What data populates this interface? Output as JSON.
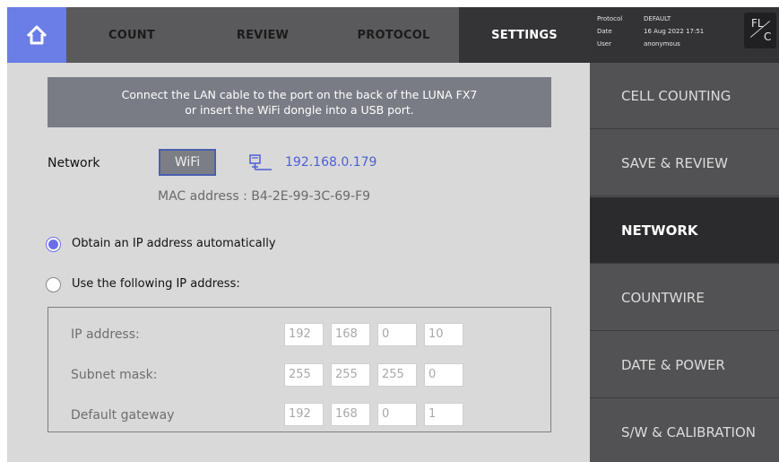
{
  "nav": {
    "home_icon": "home-icon",
    "tabs": [
      "COUNT",
      "REVIEW",
      "PROTOCOL",
      "SETTINGS"
    ],
    "active_tab": "SETTINGS"
  },
  "info": {
    "protocol_label": "Protocol",
    "protocol_value": "DEFAULT",
    "date_label": "Date",
    "date_value": "16 Aug 2022 17:51",
    "user_label": "User",
    "user_value": "anonymous",
    "mode_top": "FL",
    "mode_bottom": "C"
  },
  "menu": {
    "items": [
      "CELL COUNTING",
      "SAVE & REVIEW",
      "NETWORK",
      "COUNTWIRE",
      "DATE & POWER",
      "S/W & CALIBRATION"
    ],
    "active": "NETWORK"
  },
  "banner": {
    "line1": "Connect the LAN cable to the port on the back of the LUNA FX7",
    "line2": "or insert the WiFi dongle into a USB port."
  },
  "network": {
    "label": "Network",
    "wifi_button": "WiFi",
    "ip_icon": "network-icon",
    "ip": "192.168.0.179",
    "mac": "MAC address : B4-2E-99-3C-69-F9"
  },
  "options": {
    "auto": "Obtain an IP address automatically",
    "manual": "Use the following IP address:",
    "selected": "auto"
  },
  "fields": {
    "ip_label": "IP address:",
    "ip": [
      "192",
      "168",
      "0",
      "10"
    ],
    "subnet_label": "Subnet mask:",
    "subnet": [
      "255",
      "255",
      "255",
      "0"
    ],
    "gateway_label": "Default gateway",
    "gateway": [
      "192",
      "168",
      "0",
      "1"
    ]
  },
  "colors": {
    "accent": "#6b7de6",
    "ip_text": "#4c5ed6",
    "radio_on": "#6b6ee8"
  }
}
